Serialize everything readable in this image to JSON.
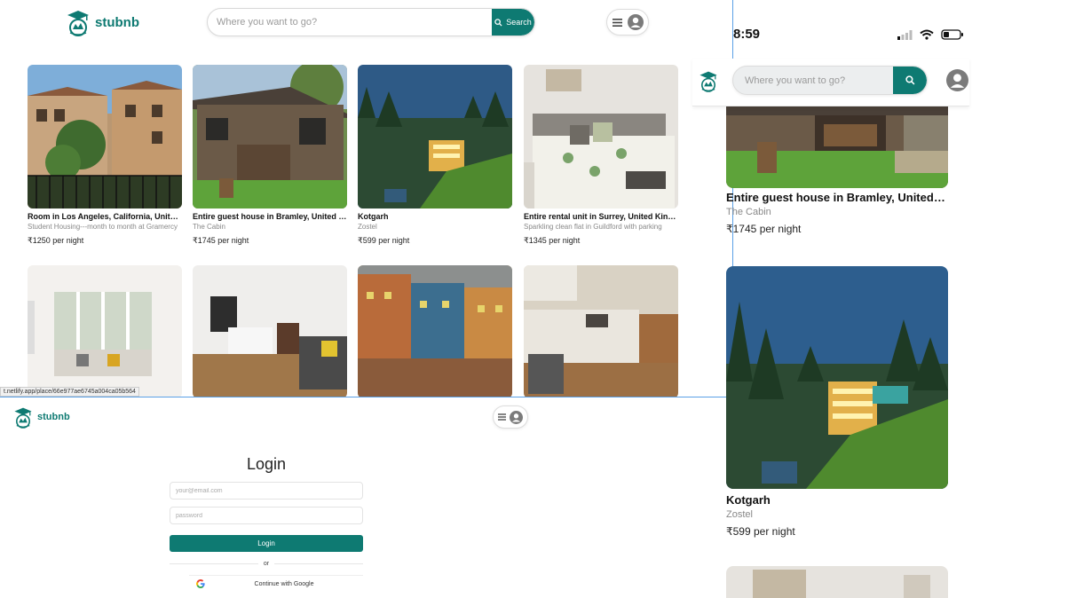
{
  "brand": {
    "name": "stubnb",
    "accent": "#0e7a72"
  },
  "desktop": {
    "search": {
      "placeholder": "Where you want to go?",
      "button_label": "Search"
    },
    "price_suffix": "per night",
    "listings": [
      {
        "title": "Room in Los Angeles, California, United States",
        "subtitle": "Student Housing---month to month at Gramercy",
        "price": "₹1250"
      },
      {
        "title": "Entire guest house in Bramley, United Kingdom",
        "subtitle": "The Cabin",
        "price": "₹1745"
      },
      {
        "title": "Kotgarh",
        "subtitle": "Zostel",
        "price": "₹599"
      },
      {
        "title": "Entire rental unit in Surrey, United Kingdom",
        "subtitle": "Sparkling clean flat in Guildford with parking",
        "price": "₹1345"
      }
    ],
    "status_url": "t.netlify.app/place/66e977ae6745a004ca05b564"
  },
  "login": {
    "title": "Login",
    "email_placeholder": "your@email.com",
    "password_placeholder": "password",
    "login_button": "Login",
    "or_text": "or",
    "google_button": "Continue with Google"
  },
  "mobile": {
    "status_time": "8:59",
    "search_placeholder": "Where you want to go?",
    "listings": [
      {
        "title": "Entire guest house in Bramley, United Kingdom",
        "subtitle": "The Cabin",
        "price": "₹1745"
      },
      {
        "title": "Kotgarh",
        "subtitle": "Zostel",
        "price": "₹599"
      }
    ]
  }
}
